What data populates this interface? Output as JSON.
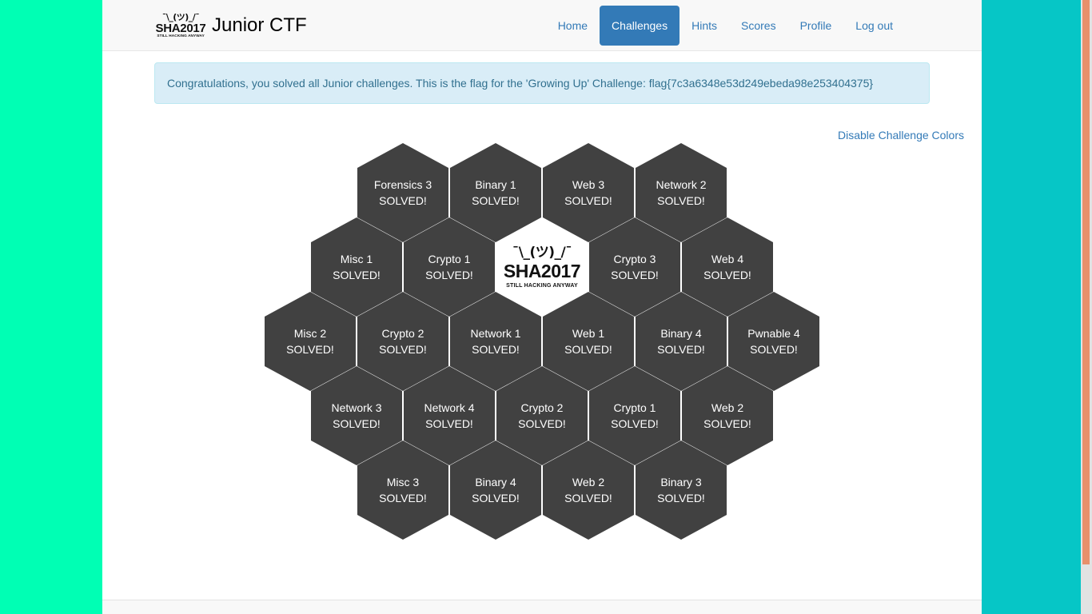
{
  "brand": {
    "logo_shrug": "¯\\_(ツ)_/¯",
    "logo_name": "SHA2017",
    "logo_tagline": "STILL HACKING ANYWAY",
    "title": "Junior CTF"
  },
  "nav": {
    "items": [
      {
        "label": "Home",
        "active": false
      },
      {
        "label": "Challenges",
        "active": true
      },
      {
        "label": "Hints",
        "active": false
      },
      {
        "label": "Scores",
        "active": false
      },
      {
        "label": "Profile",
        "active": false
      },
      {
        "label": "Log out",
        "active": false
      }
    ]
  },
  "alert": {
    "message": "Congratulations, you solved all Junior challenges. This is the flag for the 'Growing Up' Challenge: flag{7c3a6348e53d249ebeda98e253404375}",
    "flag": "flag{7c3a6348e53d249ebeda98e253404375}",
    "background_color": "#d9edf7",
    "text_color": "#31708f"
  },
  "colors_toggle": {
    "label": "Disable Challenge Colors"
  },
  "center_logo": {
    "shrug": "¯\\_(ツ)_/¯",
    "name": "SHA2017",
    "tagline": "STILL HACKING ANYWAY"
  },
  "solved_label": "SOLVED!",
  "hex_color": "#414141",
  "grid": {
    "rows": [
      {
        "cells": [
          {
            "name": "Forensics 3",
            "status": "SOLVED!",
            "type": "challenge"
          },
          {
            "name": "Binary 1",
            "status": "SOLVED!",
            "type": "challenge"
          },
          {
            "name": "Web 3",
            "status": "SOLVED!",
            "type": "challenge"
          },
          {
            "name": "Network 2",
            "status": "SOLVED!",
            "type": "challenge"
          }
        ]
      },
      {
        "cells": [
          {
            "name": "Misc 1",
            "status": "SOLVED!",
            "type": "challenge"
          },
          {
            "name": "Crypto 1",
            "status": "SOLVED!",
            "type": "challenge"
          },
          {
            "name": "",
            "status": "",
            "type": "logo"
          },
          {
            "name": "Crypto 3",
            "status": "SOLVED!",
            "type": "challenge"
          },
          {
            "name": "Web 4",
            "status": "SOLVED!",
            "type": "challenge"
          }
        ]
      },
      {
        "cells": [
          {
            "name": "Misc 2",
            "status": "SOLVED!",
            "type": "challenge"
          },
          {
            "name": "Crypto 2",
            "status": "SOLVED!",
            "type": "challenge"
          },
          {
            "name": "Network 1",
            "status": "SOLVED!",
            "type": "challenge"
          },
          {
            "name": "Web 1",
            "status": "SOLVED!",
            "type": "challenge"
          },
          {
            "name": "Binary 4",
            "status": "SOLVED!",
            "type": "challenge"
          },
          {
            "name": "Pwnable 4",
            "status": "SOLVED!",
            "type": "challenge"
          }
        ]
      },
      {
        "cells": [
          {
            "name": "Network 3",
            "status": "SOLVED!",
            "type": "challenge"
          },
          {
            "name": "Network 4",
            "status": "SOLVED!",
            "type": "challenge"
          },
          {
            "name": "Crypto 2",
            "status": "SOLVED!",
            "type": "challenge"
          },
          {
            "name": "Crypto 1",
            "status": "SOLVED!",
            "type": "challenge"
          },
          {
            "name": "Web 2",
            "status": "SOLVED!",
            "type": "challenge"
          }
        ]
      },
      {
        "cells": [
          {
            "name": "Misc 3",
            "status": "SOLVED!",
            "type": "challenge"
          },
          {
            "name": "Binary 4",
            "status": "SOLVED!",
            "type": "challenge"
          },
          {
            "name": "Web 2",
            "status": "SOLVED!",
            "type": "challenge"
          },
          {
            "name": "Binary 3",
            "status": "SOLVED!",
            "type": "challenge"
          }
        ]
      }
    ]
  },
  "page_background": {
    "left_color": "#00FFB4",
    "right_color": "#06C6C6",
    "content_color": "#ffffff"
  },
  "scrollbar": {
    "thumb_color": "#e8906b",
    "track_color": "#e2e2e2"
  }
}
